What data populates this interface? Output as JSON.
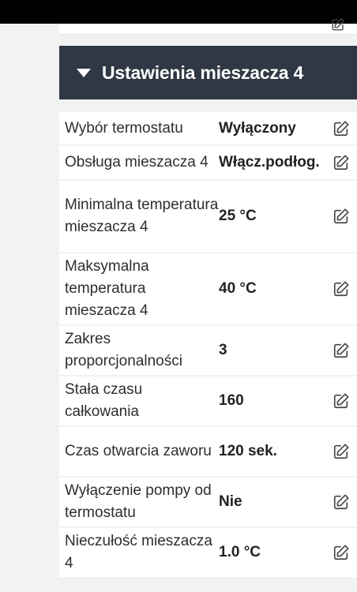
{
  "section": {
    "title": "Ustawienia mieszacza 4"
  },
  "icons": {
    "expand": "caret-down-icon",
    "edit": "edit-icon"
  },
  "rows": [
    {
      "label": "Wybór termostatu",
      "value": "Wyłączony"
    },
    {
      "label": "Obsługa mieszacza 4",
      "value": "Włącz.podłog."
    },
    {
      "label": "Minimalna temperatura mieszacza 4",
      "value": "25 °C"
    },
    {
      "label": "Maksymalna temperatura mieszacza 4",
      "value": "40 °C"
    },
    {
      "label": "Zakres proporcjonalności",
      "value": "3"
    },
    {
      "label": "Stała czasu całkowania",
      "value": "160"
    },
    {
      "label": "Czas otwarcia zaworu",
      "value": "120 sek."
    },
    {
      "label": "Wyłączenie pompy od termostatu",
      "value": "Nie"
    },
    {
      "label": "Nieczułość mieszacza 4",
      "value": "1.0 °C"
    }
  ],
  "colors": {
    "header_bg": "#2f3844",
    "page_bg": "#f2f2f2",
    "row_bg": "#ffffff"
  }
}
